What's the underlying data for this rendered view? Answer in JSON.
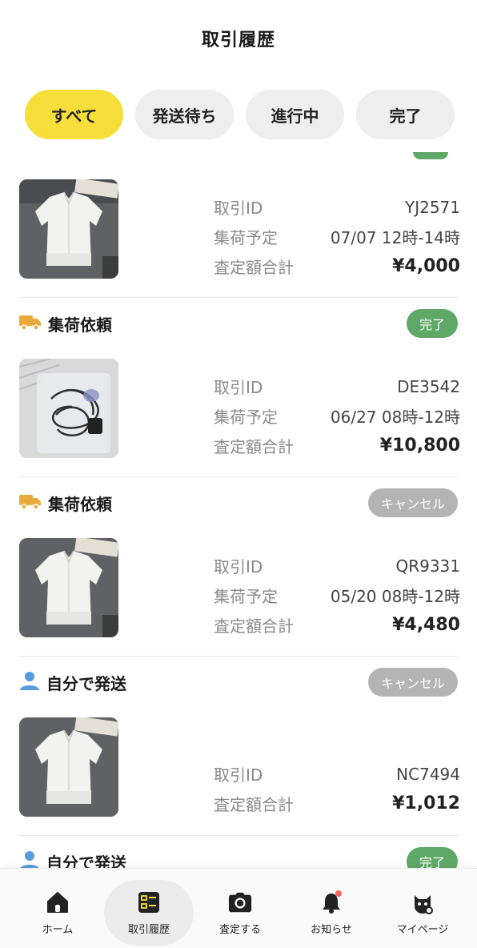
{
  "header": {
    "title": "取引履歴"
  },
  "tabs": [
    {
      "label": "すべて",
      "active": true
    },
    {
      "label": "発送待ち",
      "active": false
    },
    {
      "label": "進行中",
      "active": false
    },
    {
      "label": "完了",
      "active": false
    }
  ],
  "items": [
    {
      "id_label": "取引ID",
      "id": "YJ2571",
      "schedule_label": "集荷予定",
      "schedule": "07/07 12時-14時",
      "amount_label": "査定額合計",
      "amount": "¥4,000",
      "image": "white-blouse-photo"
    },
    {
      "section": {
        "icon": "truck-icon",
        "title": "集荷依頼",
        "status": "完了",
        "status_type": "done"
      },
      "id_label": "取引ID",
      "id": "DE3542",
      "schedule_label": "集荷予定",
      "schedule": "06/27 08時-12時",
      "amount_label": "査定額合計",
      "amount": "¥10,800",
      "image": "bagged-cables-photo"
    },
    {
      "section": {
        "icon": "truck-icon",
        "title": "集荷依頼",
        "status": "キャンセル",
        "status_type": "cancel"
      },
      "id_label": "取引ID",
      "id": "QR9331",
      "schedule_label": "集荷予定",
      "schedule": "05/20 08時-12時",
      "amount_label": "査定額合計",
      "amount": "¥4,480",
      "image": "white-blouse-photo"
    },
    {
      "section": {
        "icon": "person-icon",
        "title": "自分で発送",
        "status": "キャンセル",
        "status_type": "cancel"
      },
      "id_label": "取引ID",
      "id": "NC7494",
      "amount_label": "査定額合計",
      "amount": "¥1,012",
      "image": "white-blouse-photo"
    }
  ],
  "peek_section": {
    "icon": "person-icon",
    "title": "自分で発送",
    "status": "完了",
    "status_type": "done"
  },
  "colors": {
    "accent": "#f6df3b",
    "done": "#5fa867",
    "cancel": "#b4b4b4",
    "truck": "#e9a93b",
    "person": "#5a9be0"
  },
  "nav": [
    {
      "label": "ホーム",
      "icon": "home-icon",
      "active": false
    },
    {
      "label": "取引履歴",
      "icon": "history-icon",
      "active": true
    },
    {
      "label": "査定する",
      "icon": "camera-icon",
      "active": false
    },
    {
      "label": "お知らせ",
      "icon": "bell-icon",
      "active": false,
      "has_dot": true
    },
    {
      "label": "マイページ",
      "icon": "cat-icon",
      "active": false
    }
  ]
}
